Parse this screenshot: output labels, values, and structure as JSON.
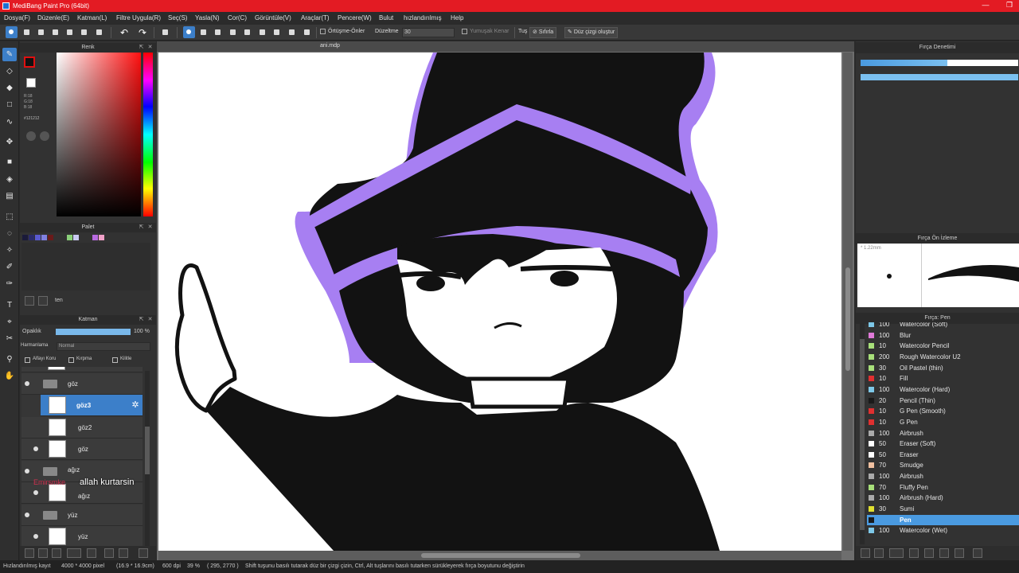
{
  "window": {
    "title": "MediBang Paint Pro (64bit)",
    "min": "—",
    "max": "❐",
    "close": "✕"
  },
  "menu": [
    "Dosya(F)",
    "Düzenle(E)",
    "Katman(L)",
    "Filtre Uygula(R)",
    "Seç(S)",
    "Yasla(N)",
    "Cor(C)",
    "Görüntüle(V)",
    "Araçlar(T)",
    "Pencere(W)",
    "Bulut",
    "hızlandırılmış",
    "Help"
  ],
  "toolbar": {
    "overlap_label": "Örtüşme-Önler",
    "correction_label": "Düzeltme",
    "correction_value": "30",
    "soft_edge_label": "Yumuşak Kenar",
    "tu_label": "Tuş",
    "reset_label": "Sıfırla",
    "line_label": "Düz çizgi oluştur"
  },
  "color_panel": {
    "title": "Renk",
    "r": "R:18",
    "g": "G:18",
    "b": "B:18",
    "hex": "#121212",
    "fg_color": "#121212",
    "accent": "#e01010"
  },
  "palette_panel": {
    "title": "Palet",
    "swatches": [
      "#1a1a3a",
      "#2a2a6a",
      "#5a5ad0",
      "#8080e0",
      "#6a1a1a",
      "#8ad07a",
      "#c8c8f0",
      "#b86ae0",
      "#f0a0c8"
    ],
    "name": "ten"
  },
  "layer_panel": {
    "title": "Katman",
    "opacity_label": "Opaklık",
    "opacity_value": "100 %",
    "blend_label": "Harmanlama",
    "blend_value": "Normal",
    "alpha_lock": "Alfayı Koru",
    "clipping": "Kırpma",
    "lock": "Kilitle",
    "layers": [
      {
        "name": "göz",
        "kind": "folder",
        "visible": true
      },
      {
        "name": "göz3",
        "kind": "layer",
        "visible": false,
        "selected": true
      },
      {
        "name": "göz2",
        "kind": "layer",
        "visible": false
      },
      {
        "name": "göz",
        "kind": "layer",
        "visible": true
      },
      {
        "name": "ağız",
        "kind": "folder",
        "visible": true
      },
      {
        "name": "ağız",
        "kind": "layer",
        "visible": true
      },
      {
        "name": "yüz",
        "kind": "folder",
        "visible": true
      },
      {
        "name": "yüz",
        "kind": "layer",
        "visible": true
      }
    ],
    "overlay_red": "Emirsmke",
    "overlay_white": "allah kurtarsin"
  },
  "canvas": {
    "tab": "ani.mdp",
    "outline_color": "#a77ff2"
  },
  "brush_control": {
    "title": "Fırça Denetimi"
  },
  "brush_preview": {
    "title": "Fırça Ön İzleme",
    "size": "1.22mm"
  },
  "brush_list": {
    "title": "Fırça: Pen",
    "items": [
      {
        "size": "100",
        "name": "Watercolor (Soft)",
        "color": "#7ec8e8"
      },
      {
        "size": "100",
        "name": "Blur",
        "color": "#e07ad8"
      },
      {
        "size": "10",
        "name": "Watercolor Pencil",
        "color": "#a8e07a"
      },
      {
        "size": "200",
        "name": "Rough Watercolor U2",
        "color": "#a8e07a"
      },
      {
        "size": "30",
        "name": "Oil Pastel (thin)",
        "color": "#a8e07a"
      },
      {
        "size": "10",
        "name": "Fill",
        "color": "#e03030"
      },
      {
        "size": "100",
        "name": "Watercolor (Hard)",
        "color": "#7ec8e8"
      },
      {
        "size": "20",
        "name": "Pencil (Thin)",
        "color": "#1a1a1a"
      },
      {
        "size": "10",
        "name": "G Pen (Smooth)",
        "color": "#e03030"
      },
      {
        "size": "10",
        "name": "G Pen",
        "color": "#e03030"
      },
      {
        "size": "100",
        "name": "Airbrush",
        "color": "#aaaaaa"
      },
      {
        "size": "50",
        "name": "Eraser (Soft)",
        "color": "#ffffff"
      },
      {
        "size": "50",
        "name": "Eraser",
        "color": "#ffffff"
      },
      {
        "size": "70",
        "name": "Smudge",
        "color": "#f0c0a0"
      },
      {
        "size": "100",
        "name": "Airbrush",
        "color": "#aaaaaa"
      },
      {
        "size": "70",
        "name": "Fluffy Pen",
        "color": "#a8e07a"
      },
      {
        "size": "100",
        "name": "Airbrush (Hard)",
        "color": "#aaaaaa"
      },
      {
        "size": "30",
        "name": "Sumi",
        "color": "#e0e030"
      },
      {
        "size": "",
        "name": "Pen",
        "color": "#1a1a1a",
        "selected": true
      },
      {
        "size": "100",
        "name": "Watercolor (Wet)",
        "color": "#7ec8e8"
      }
    ]
  },
  "status": {
    "mode": "Hızlandırılmış kayıt",
    "size": "4000 * 4000 pixel",
    "physical": "(16.9 * 16.9cm)",
    "dpi": "600 dpi",
    "zoom": "39 %",
    "coords": "( 295, 2770 )",
    "hint": "Shift tuşunu basılı tutarak düz bir çizgi çizin, Ctrl, Alt tuşlarını basılı tutarken sürükleyerek fırça boyutunu değiştirin"
  }
}
